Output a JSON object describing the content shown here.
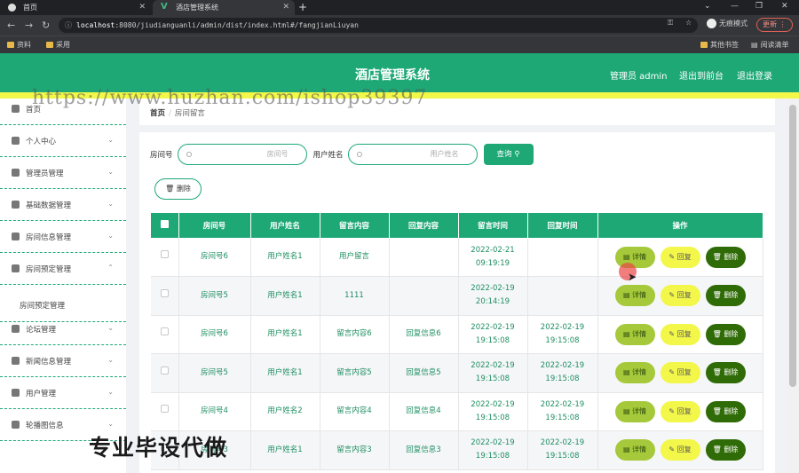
{
  "browser": {
    "tabs": [
      {
        "label": "首页"
      },
      {
        "label": "酒店管理系统"
      }
    ],
    "url_host": "localhost",
    "url_rest": ":8080/jiudianguanli/admin/dist/index.html#/fangjianLiuyan",
    "profile_label": "无痕模式",
    "update_label": "更新",
    "bookmarks": [
      {
        "label": "资料"
      },
      {
        "label": "采用"
      },
      {
        "label": "其他书签"
      },
      {
        "label": "阅读清单"
      }
    ]
  },
  "header": {
    "title": "酒店管理系统",
    "admin_label": "管理员 admin",
    "back_label": "退出到前台",
    "logout_label": "退出登录"
  },
  "watermark_text": "https://www.huzhan.com/ishop39397",
  "bottom_watermark": "专业毕设代做",
  "sidebar": {
    "items": [
      {
        "label": "首页",
        "icon": "home-icon"
      },
      {
        "label": "个人中心",
        "icon": "user-icon"
      },
      {
        "label": "管理员管理",
        "icon": "send-icon"
      },
      {
        "label": "基础数据管理",
        "icon": "copy-icon"
      },
      {
        "label": "房间信息管理",
        "icon": "gauge-icon"
      },
      {
        "label": "房间预定管理",
        "icon": "location-icon"
      },
      {
        "label": "论坛管理",
        "icon": "navigation-icon"
      },
      {
        "label": "新闻信息管理",
        "icon": "user-icon"
      },
      {
        "label": "用户管理",
        "icon": "chart-icon"
      },
      {
        "label": "轮播图信息",
        "icon": "list-icon"
      }
    ],
    "submenu_label": "房间预定管理"
  },
  "breadcrumb": {
    "home": "首页",
    "separator": "/",
    "current": "房间留言"
  },
  "search": {
    "room_label": "房间号",
    "room_placeholder": "房间号",
    "user_label": "用户姓名",
    "user_placeholder": "用户姓名",
    "query_label": "查询",
    "delete_label": "删除"
  },
  "table": {
    "headers": [
      "房间号",
      "用户姓名",
      "留言内容",
      "回复内容",
      "留言时间",
      "回复时间",
      "操作"
    ],
    "rows": [
      {
        "room": "房间号6",
        "user": "用户姓名1",
        "message": "用户留言",
        "reply": "",
        "msg_time": "2022-02-21 09:19:19",
        "reply_time": ""
      },
      {
        "room": "房间号5",
        "user": "用户姓名1",
        "message": "1111",
        "reply": "",
        "msg_time": "2022-02-19 20:14:19",
        "reply_time": ""
      },
      {
        "room": "房间号6",
        "user": "用户姓名1",
        "message": "留言内容6",
        "reply": "回复信息6",
        "msg_time": "2022-02-19 19:15:08",
        "reply_time": "2022-02-19 19:15:08"
      },
      {
        "room": "房间号5",
        "user": "用户姓名1",
        "message": "留言内容5",
        "reply": "回复信息5",
        "msg_time": "2022-02-19 19:15:08",
        "reply_time": "2022-02-19 19:15:08"
      },
      {
        "room": "房间号4",
        "user": "用户姓名2",
        "message": "留言内容4",
        "reply": "回复信息4",
        "msg_time": "2022-02-19 19:15:08",
        "reply_time": "2022-02-19 19:15:08"
      },
      {
        "room": "房间号3",
        "user": "用户姓名1",
        "message": "留言内容3",
        "reply": "回复信息3",
        "msg_time": "2022-02-19 19:15:08",
        "reply_time": "2022-02-19 19:15:08"
      }
    ],
    "op_detail": "详情",
    "op_reply": "回复",
    "op_delete": "删除"
  },
  "colors": {
    "primary": "#1ea876",
    "yellow": "#f2f74a",
    "detail": "#a5c93a",
    "delete": "#2f6b06"
  }
}
